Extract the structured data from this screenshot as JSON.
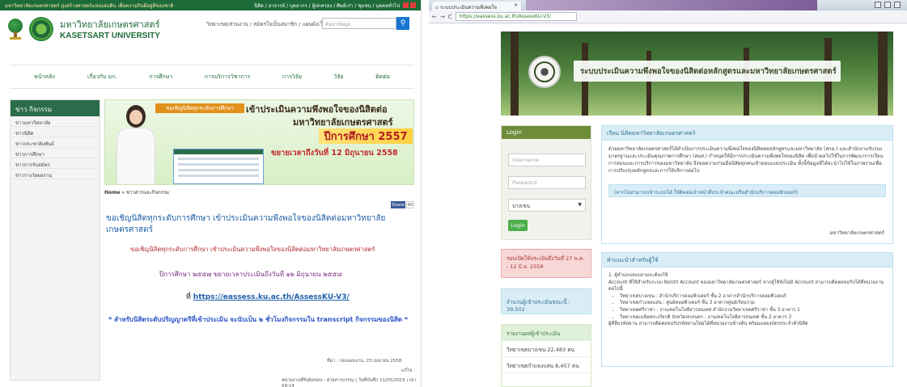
{
  "left": {
    "topbar": {
      "left_text": "มหาวิทยาลัยเกษตรศาสตร์ มุ่งสร้างศาสตร์แห่งแผ่นดิน เพื่อความกินดีอยู่ดีของชาติ",
      "right_text": "นิสิต / อาจารย์ / บุคลากร / ผู้ปกครอง / ศิษย์เก่า / ชุมชน / บุคคลทั่วไป"
    },
    "header": {
      "name_th": "มหาวิทยาลัยเกษตรศาสตร์",
      "name_en": "KASETSART UNIVERSITY",
      "links": "วิทยาเขต/ส่วนงาน / สมัครใจเป็นสมาชิก / แผนผังเว็บไซต์",
      "search_placeholder": "ค้นหาข้อมูล"
    },
    "nav": [
      "หน้าหลัก",
      "เกี่ยวกับ มก.",
      "การศึกษา",
      "การบริการวิชาการ",
      "การวิจัย",
      "วิจัย",
      "ติดต่อ"
    ],
    "sidebar": {
      "heading": "ข่าว กิจกรรม",
      "items": [
        "ข่าวมหาวิทยาลัย",
        "ข่าวนิสิต",
        "ข่าวประชาสัมพันธ์",
        "ข่าวการศึกษา",
        "ข่าวการรับสมัคร",
        "ข่าวรางวัลผลงาน"
      ]
    },
    "banner": {
      "tag": "ขอเชิญนิสิตทุกระดับการศึกษา",
      "title1": "เข้าประเมินความพึงพอใจของนิสิตต่อ",
      "title2": "มหาวิทยาลัยเกษตรศาสตร์",
      "year": "ปีการศึกษา 2557",
      "date": "ขยายเวลาถึงวันที่ 12 มิถุนายน 2558"
    },
    "breadcrumb": {
      "home": "Home",
      "trail": "ข่าวสารและกิจกรรม"
    },
    "share": {
      "label": "Share",
      "count": "40"
    },
    "article": {
      "title": "ขอเชิญนิสิตทุกระดับการศึกษา เข้าประเมินความพึงพอใจของนิสิตต่อมหาวิทยาลัยเกษตรศาสตร์",
      "line1": "ขอเชิญนิสิตทุกระดับการศึกษา เข้าประเมินความพึงพอใจของนิสิตต่อมหาวิทยาลัยเกษตรศาสตร์",
      "line2": "ปีการศึกษา ๒๕๕๗ ขยายเวลาประเมินถึงวันที่ ๑๒ มิถุนายน ๒๕๕๘",
      "line3_prefix": "ที่ ",
      "line3_link": "https://eassess.ku.ac.th/AssessKU-V3/",
      "line4": "* สำหรับนิสิตระดับปริญญาตรีที่เข้าประเมิน จะนับเป็น ๒ ชั่วโมงกิจกรรมใน transcript กิจกรรมของนิสิต *",
      "meta1": "ที่มา : กองแผนงาน, 23 เมษายน 2558",
      "meta2": "แก้ไข :",
      "meta3": "หน่วยงานที่รับผิดชอบ : ฝ่ายสารบรรณ | วันที่บันทึก 11/05/2015 เวลา 09:14"
    }
  },
  "right": {
    "tab": {
      "title": "ระบบประเมินความพึงพอใจ"
    },
    "url": "https://eassess.ku.ac.th/AssessKU-V3/",
    "banner_title": "ระบบประเมินความพึงพอใจของนิสิตต่อหลักสูตรและมหาวิทยาลัยเกษตรศาสตร์",
    "login": {
      "heading": "Login",
      "username_placeholder": "Username",
      "password_placeholder": "Password",
      "select_value": "บางเขน",
      "button": "Login"
    },
    "period": "รอบเปิดให้ประเมินถึงวันที่ 27 พ.ค. - 12 มิ.ย. 2558",
    "count": "จำนวนผู้เข้าประเมินขณะนี้ : 39,502",
    "stats": {
      "heading": "รายงานผลผู้เข้าประเมิน",
      "rows": [
        "วิทยาเขตบางเขน 22,483 คน",
        "วิทยาเขตกำแพงแสน 8,457 คน"
      ]
    },
    "panel1": {
      "heading": "เรียน นิสิตมหาวิทยาลัยเกษตรศาสตร์",
      "body": "ด้วยมหาวิทยาลัยเกษตรศาสตร์ได้ดำเนินการประเมินความพึงพอใจของนิสิตต่อหลักสูตรและมหาวิทยาลัย (สกอ.) และสำนักงานรับรองมาตรฐานและประเมินคุณภาพการศึกษา (สมศ.) กำหนดให้มีการประเมินความพึงพอใจของนิสิต เพื่อนำผลไปใช้ในการพัฒนาการเรียนการสอนและการบริการของมหาวิทยาลัย จึงขอความร่วมมือนิสิตทุกคนเข้าตอบแบบประเมิน ทั้งนี้ข้อมูลที่ได้จะนำไปใช้ในภาพรวมเพื่อการปรับปรุงหลักสูตรและการให้บริการต่อไป",
      "info": "(หากไม่สามารถเข้าระบบได้ ให้ติดต่อเจ้าหน้าที่ประจำคณะหรือสำนักบริการคอมพิวเตอร์)",
      "signoff": "มหาวิทยาลัยเกษตรศาสตร์"
    },
    "panel2": {
      "heading": "คำแนะนำสำหรับผู้ใช้",
      "intro": "1. ผู้ทำแบบสอบถามจะต้องใช้",
      "lines": [
        "Account ที่ใช้สำหรับระบบ Nontri Account ของมหาวิทยาลัยเกษตรศาสตร์ หากผู้ใช้ยังไม่มี Account สามารถติดต่อขอรับได้ที่หน่วยงานต่อไปนี้",
        "วิทยาเขตบางเขน : สำนักบริการคอมพิวเตอร์ ชั้น 2 อาคารสำนักบริการคอมพิวเตอร์",
        "วิทยาเขตกำแพงแสน : ศูนย์คอมพิวเตอร์ ชั้น 3 อาคารศูนย์เรียนรวม",
        "วิทยาเขตศรีราชา : งานเทคโนโลยีสารสนเทศ สำนักงานวิทยาเขตศรีราชา ชั้น 3 อาคาร 1",
        "วิทยาเขตเฉลิมพระเกียรติ จังหวัดสกลนคร : งานเทคโนโลยีสารสนเทศ ชั้น 2 อาคาร 3"
      ],
      "footer": "ผู้ที่ลืมรหัสผ่าน สามารถติดต่อขอรับรหัสผ่านใหม่ได้ที่หน่วยงานข้างต้น พร้อมแสดงบัตรประจำตัวนิสิต"
    }
  }
}
